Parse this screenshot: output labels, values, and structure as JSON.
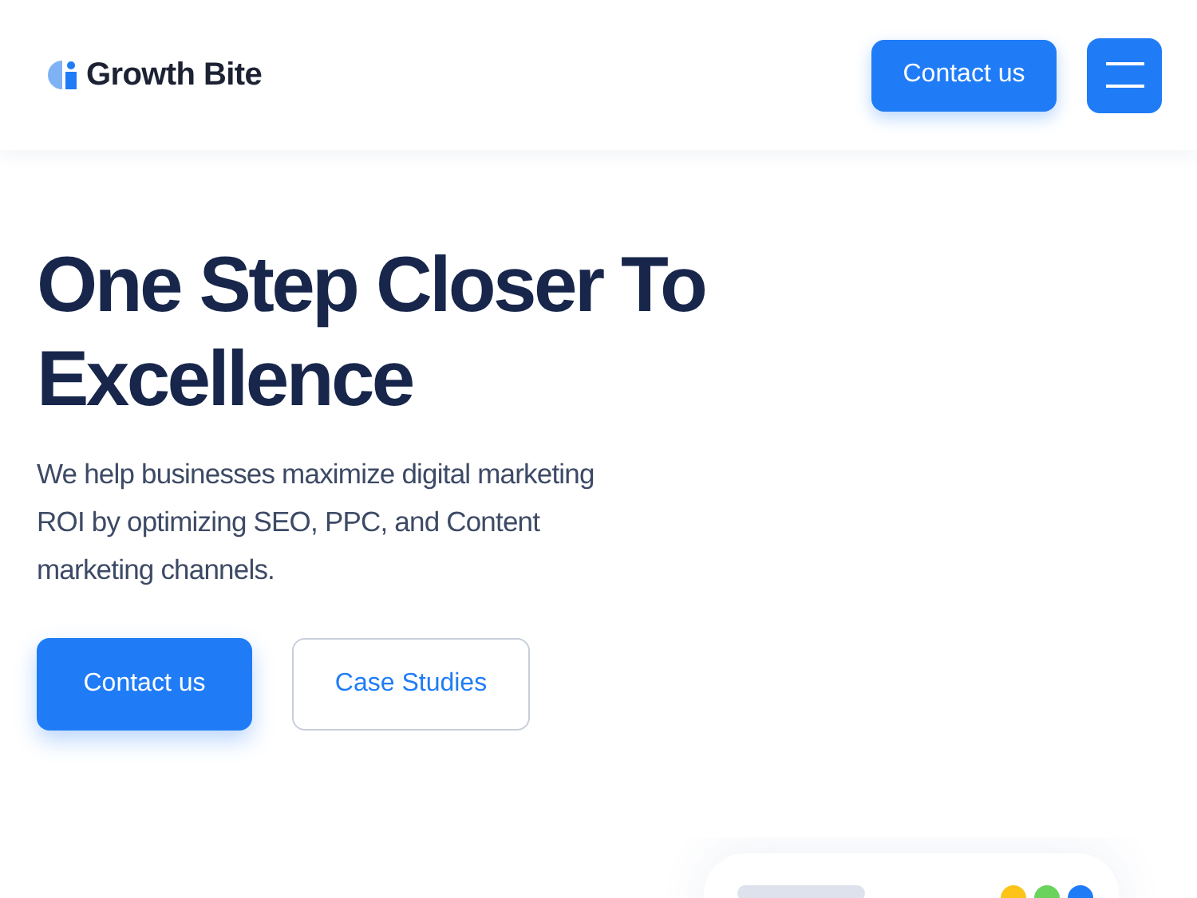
{
  "header": {
    "logo": "Growth Bite",
    "contact_button": "Contact us"
  },
  "hero": {
    "title": "One Step Closer To Excellence",
    "text": "We help businesses maximize digital marketing ROI by optimizing SEO, PPC, and Content marketing channels.",
    "buttons": [
      {
        "label": "Contact us",
        "kind": "primary"
      },
      {
        "label": "Case Studies",
        "kind": "outline"
      }
    ]
  }
}
